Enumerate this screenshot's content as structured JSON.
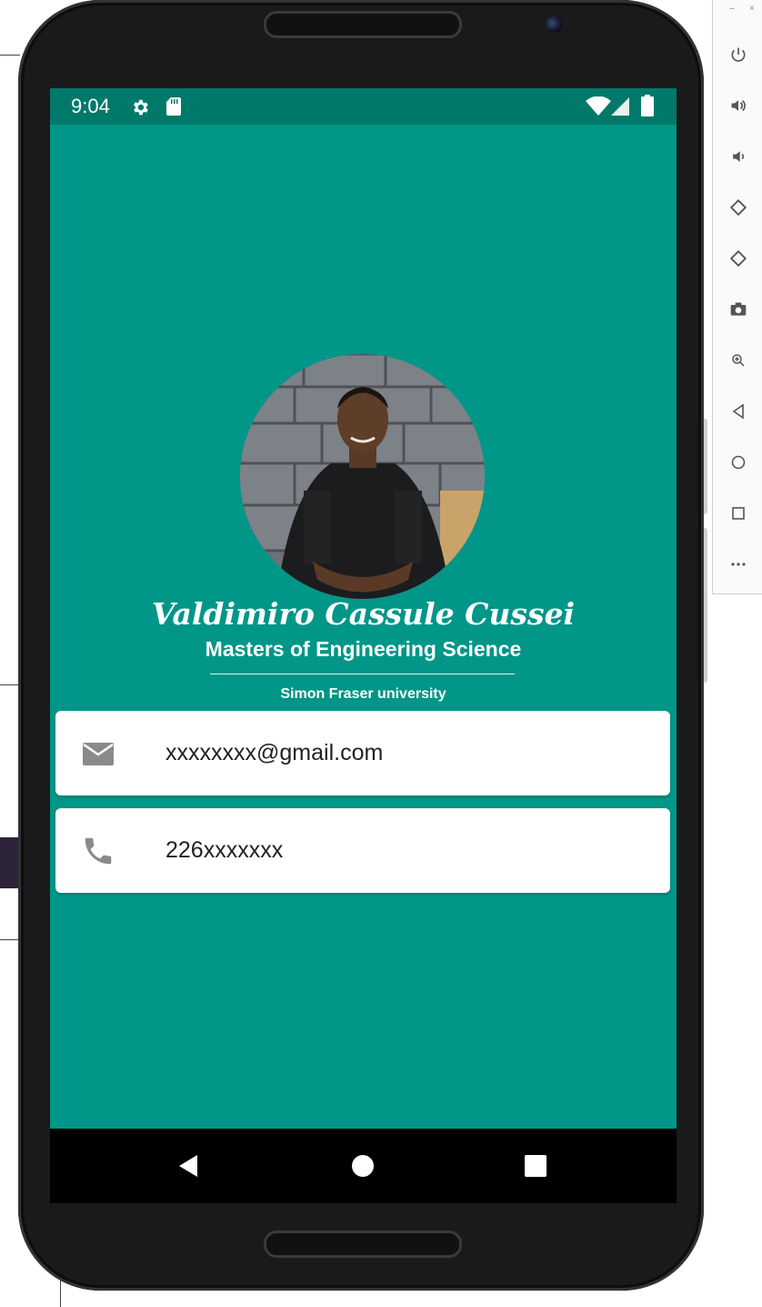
{
  "status_bar": {
    "time": "9:04",
    "left_icons": [
      "gear-icon",
      "sd-card-icon"
    ],
    "right_icons": [
      "wifi-icon",
      "signal-icon",
      "battery-icon"
    ]
  },
  "profile": {
    "name": "Valdimiro Cassule Cussei",
    "degree": "Masters of Engineering Science",
    "school": "Simon Fraser university"
  },
  "contacts": [
    {
      "icon": "mail-icon",
      "value": "xxxxxxxx@gmail.com"
    },
    {
      "icon": "phone-icon",
      "value": "226xxxxxxx"
    }
  ],
  "nav_bar": [
    "back-icon",
    "home-icon",
    "recents-icon"
  ],
  "emulator_toolbar": {
    "window_controls": [
      "minimize",
      "close"
    ],
    "buttons": [
      "power-icon",
      "volume-up-icon",
      "volume-down-icon",
      "rotate-left-icon",
      "rotate-right-icon",
      "camera-icon",
      "zoom-icon",
      "back-icon",
      "home-icon",
      "overview-icon",
      "more-icon"
    ]
  },
  "colors": {
    "primary": "#009688",
    "primary_dark": "#00796b",
    "card": "#ffffff",
    "icon_gray": "#8a8a8a"
  }
}
